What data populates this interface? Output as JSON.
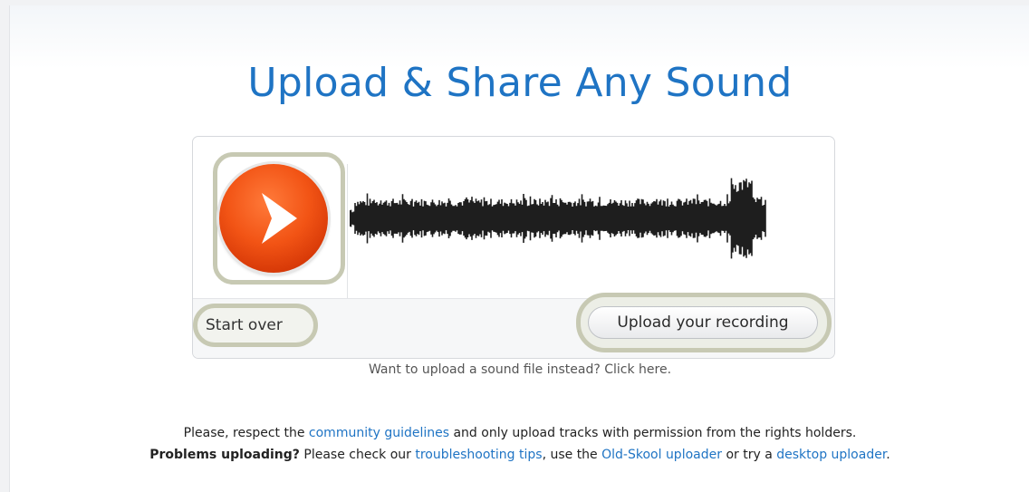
{
  "title": "Upload & Share Any Sound",
  "recorder": {
    "play_icon": "play-icon",
    "start_over_label": "Start over",
    "upload_label": "Upload your recording",
    "play_color": "#f25415",
    "highlight_color": "#c7c9b3"
  },
  "alt_upload_text": "Want to upload a sound file instead? Click here.",
  "notice": {
    "line1_before": "Please, respect the ",
    "line1_link": "community guidelines",
    "line1_after": " and only upload tracks with permission from the rights holders.",
    "line2_bold": "Problems uploading?",
    "line2_before": " Please check our ",
    "line2_link1": "troubleshooting tips",
    "line2_mid1": ", use the ",
    "line2_link2": "Old-Skool uploader",
    "line2_mid2": " or try a ",
    "line2_link3": "desktop uploader",
    "line2_end": "."
  },
  "colors": {
    "title": "#1f74c4",
    "link": "#1f74c4"
  }
}
